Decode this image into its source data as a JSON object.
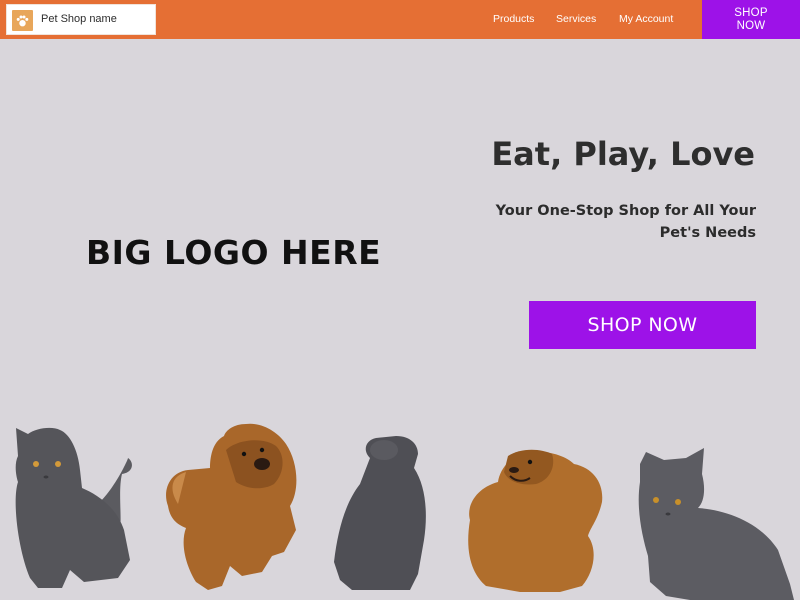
{
  "header": {
    "brand_name": "Pet Shop name",
    "brand_icon": "paw-icon",
    "nav": {
      "products": "Products",
      "services": "Services",
      "account": "My Account"
    },
    "shop_now_line1": "SHOP",
    "shop_now_line2": "NOW"
  },
  "hero": {
    "logo_placeholder": "BIG LOGO HERE",
    "headline": "Eat, Play, Love",
    "subheadline": "Your One-Stop Shop for All Your Pet's Needs",
    "cta_label": "SHOP NOW"
  },
  "colors": {
    "header_bg": "#e56f34",
    "accent_purple": "#9d12e8",
    "page_bg": "#d9d6db"
  }
}
